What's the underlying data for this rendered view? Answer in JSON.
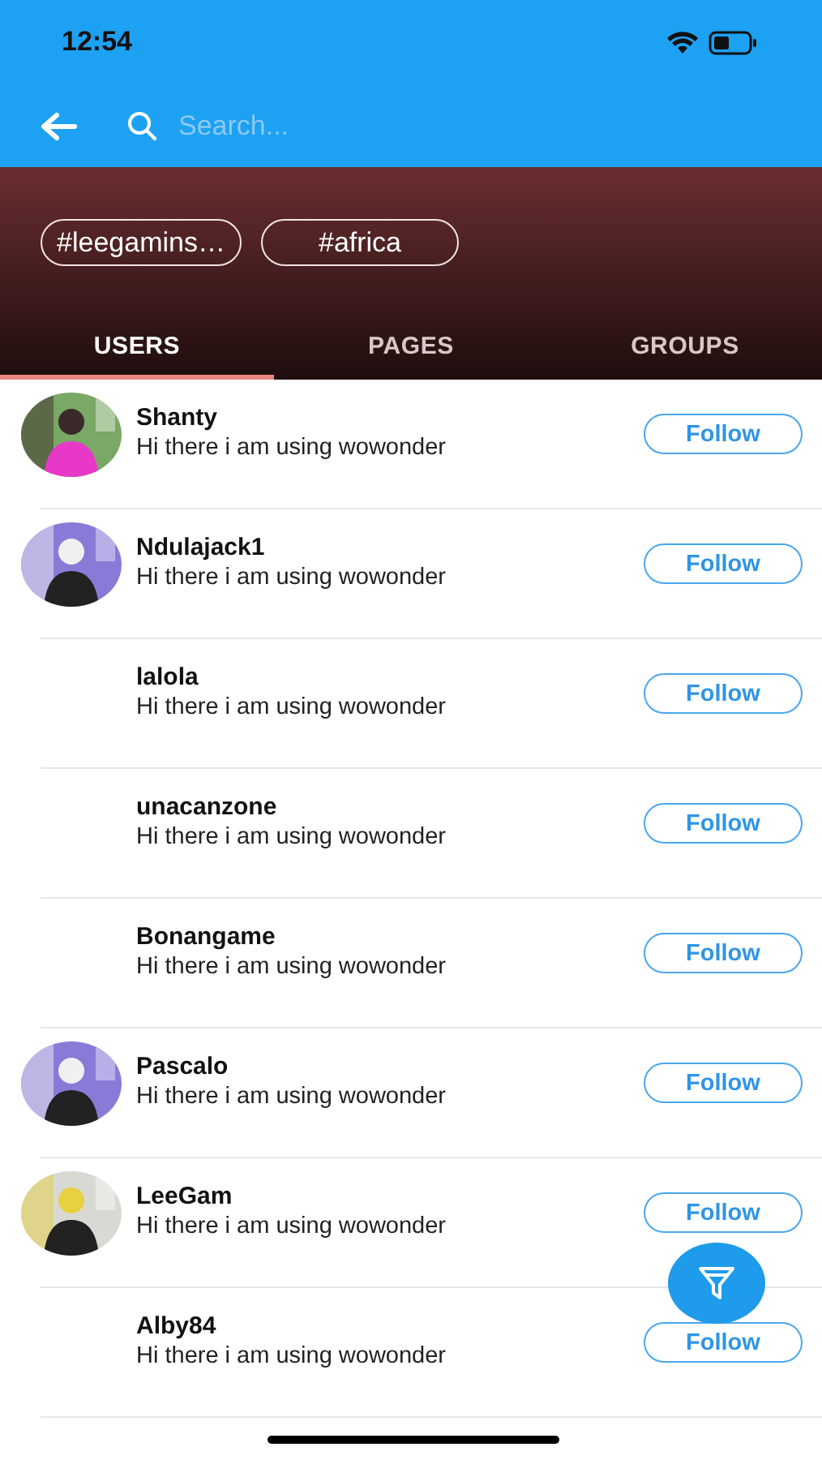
{
  "status_bar": {
    "time": "12:54"
  },
  "search": {
    "placeholder": "Search..."
  },
  "hashtags": [
    "#leegamins…",
    "#africa"
  ],
  "tabs": [
    {
      "label": "USERS",
      "selected": true
    },
    {
      "label": "PAGES",
      "selected": false
    },
    {
      "label": "GROUPS",
      "selected": false
    }
  ],
  "users": [
    {
      "name": "Shanty",
      "bio": "Hi there i am using wowonder",
      "button": "Follow"
    },
    {
      "name": "Ndulajack1",
      "bio": "Hi there i am using wowonder",
      "button": "Follow"
    },
    {
      "name": "lalola",
      "bio": "Hi there i am using wowonder",
      "button": "Follow"
    },
    {
      "name": "unacanzone",
      "bio": "Hi there i am using wowonder",
      "button": "Follow"
    },
    {
      "name": "Bonangame",
      "bio": "Hi there i am using wowonder",
      "button": "Follow"
    },
    {
      "name": "Pascalo",
      "bio": "Hi there i am using wowonder",
      "button": "Follow"
    },
    {
      "name": "LeeGam",
      "bio": "Hi there i am using wowonder",
      "button": "Follow"
    },
    {
      "name": "Alby84",
      "bio": "Hi there i am using wowonder",
      "button": "Follow"
    }
  ]
}
